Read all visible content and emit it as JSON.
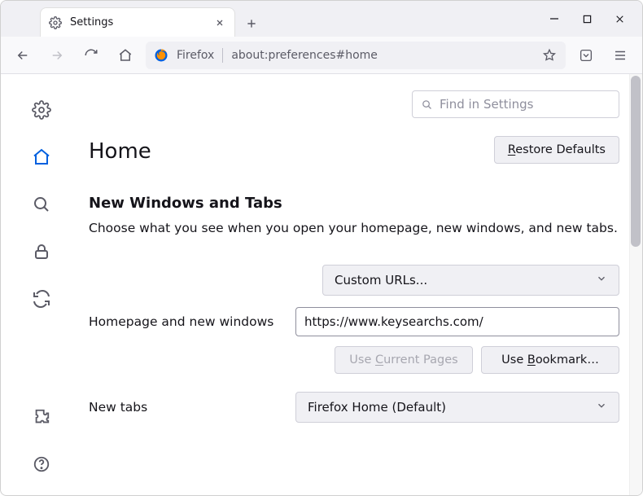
{
  "tab": {
    "title": "Settings"
  },
  "urlbar": {
    "product": "Firefox",
    "address": "about:preferences#home"
  },
  "search": {
    "placeholder": "Find in Settings"
  },
  "heading": "Home",
  "restore_btn": "Restore Defaults",
  "restore_accel": "R",
  "section": {
    "title": "New Windows and Tabs",
    "desc": "Choose what you see when you open your homepage, new windows, and new tabs."
  },
  "homepage": {
    "mode_select": "Custom URLs...",
    "row_label": "Homepage and new windows",
    "url_value": "https://www.keysearchs.com/",
    "use_current": "Use Current Pages",
    "use_current_accel": "C",
    "use_bookmark": "Use Bookmark…",
    "use_bookmark_accel": "B"
  },
  "newtabs": {
    "row_label": "New tabs",
    "select_value": "Firefox Home (Default)"
  }
}
